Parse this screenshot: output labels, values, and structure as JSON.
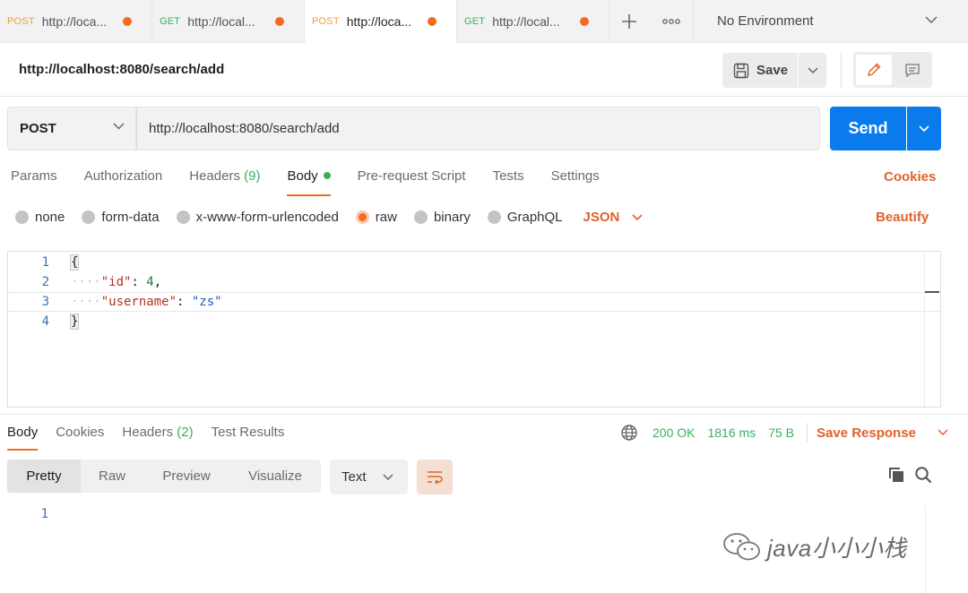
{
  "tabs": [
    {
      "method": "POST",
      "url": "http://loca...",
      "active": false
    },
    {
      "method": "GET",
      "url": "http://local...",
      "active": false
    },
    {
      "method": "POST",
      "url": "http://loca...",
      "active": true
    },
    {
      "method": "GET",
      "url": "http://local...",
      "active": false
    }
  ],
  "tab_actions": {
    "new_tab_symbol": "+",
    "more_symbol": "ooo"
  },
  "environment": {
    "label": "No Environment"
  },
  "request": {
    "title": "http://localhost:8080/search/add",
    "save_label": "Save",
    "method": "POST",
    "url": "http://localhost:8080/search/add",
    "send_label": "Send"
  },
  "request_tabs": {
    "params": "Params",
    "authorization": "Authorization",
    "headers": "Headers",
    "headers_count": "(9)",
    "body": "Body",
    "prerequest": "Pre-request Script",
    "tests": "Tests",
    "settings": "Settings",
    "cookies": "Cookies"
  },
  "body_types": {
    "none": "none",
    "form_data": "form-data",
    "urlencoded": "x-www-form-urlencoded",
    "raw": "raw",
    "binary": "binary",
    "graphql": "GraphQL",
    "language": "JSON",
    "beautify": "Beautify"
  },
  "editor": {
    "line_numbers": [
      "1",
      "2",
      "3",
      "4"
    ],
    "open_brace": "{",
    "close_brace": "}",
    "indent": "····",
    "line2_key": "\"id\"",
    "line2_value": "4",
    "line3_key": "\"username\"",
    "line3_value": "\"zs\""
  },
  "response_tabs": {
    "body": "Body",
    "cookies": "Cookies",
    "headers": "Headers",
    "headers_count": "(2)",
    "test_results": "Test Results"
  },
  "response_meta": {
    "status": "200 OK",
    "time": "1816 ms",
    "size": "75 B",
    "save_response": "Save Response"
  },
  "response_format": {
    "pretty": "Pretty",
    "raw": "Raw",
    "preview": "Preview",
    "visualize": "Visualize",
    "type": "Text"
  },
  "response_body": {
    "line_numbers": [
      "1"
    ]
  },
  "watermark": {
    "text": "java小小小栈"
  },
  "colors": {
    "accent": "#f26b21",
    "send": "#097bed",
    "success": "#3cae61",
    "link": "#e0622a"
  }
}
